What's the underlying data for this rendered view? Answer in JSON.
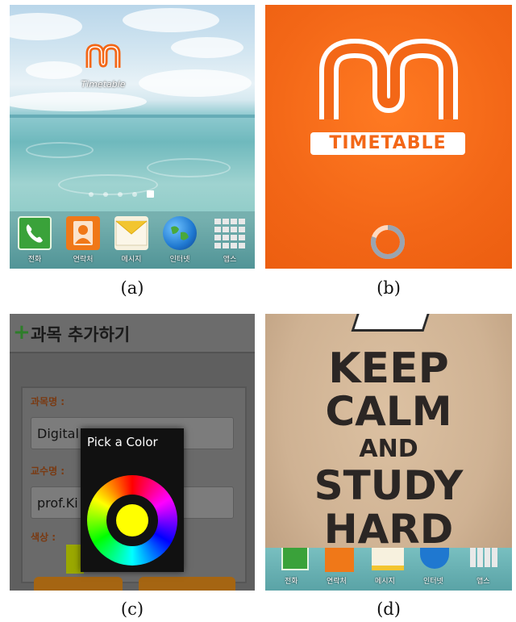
{
  "captions": {
    "a": "(a)",
    "b": "(b)",
    "c": "(c)",
    "d": "(d)"
  },
  "panel_a": {
    "app_label": "Timetable",
    "pages": 5,
    "selected_page": 5,
    "dock": [
      {
        "label": "전화",
        "icon": "phone-icon",
        "color": "#3aa23a"
      },
      {
        "label": "연락처",
        "icon": "contacts-icon",
        "color": "#f07818"
      },
      {
        "label": "메시지",
        "icon": "message-icon",
        "color": "#f2c530"
      },
      {
        "label": "인터넷",
        "icon": "globe-icon",
        "color": "#1f78d0"
      },
      {
        "label": "앱스",
        "icon": "apps-grid-icon",
        "color": "#dddddd"
      }
    ]
  },
  "panel_b": {
    "brand": "TIMETABLE",
    "accent": "#f36717",
    "loader": "loading-spinner-icon"
  },
  "panel_c": {
    "title": "과목 추가하기",
    "title_icon": "plus-icon",
    "course_label": "과목명 :",
    "course_value": "Digital",
    "professor_label": "교수명 :",
    "professor_value": "prof.Ki",
    "color_label": "색상 :",
    "picker_title": "Pick a Color",
    "selected_color": "#ffff00",
    "button_ok": "",
    "button_cancel": ""
  },
  "panel_d": {
    "lines": [
      "KEEP",
      "CALM",
      "AND",
      "STUDY",
      "HARD"
    ],
    "dock_labels": [
      "전화",
      "연락처",
      "메시지",
      "인터넷",
      "앱스"
    ]
  }
}
